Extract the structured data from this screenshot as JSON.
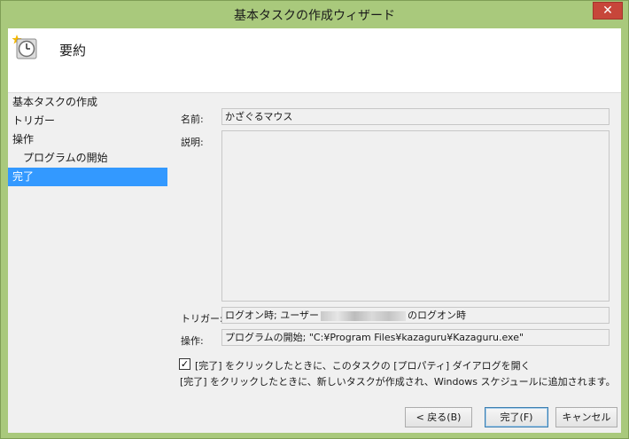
{
  "window": {
    "title": "基本タスクの作成ウィザード",
    "close_label": "✕"
  },
  "header": {
    "title": "要約",
    "icon": "scheduled-task-clock-icon"
  },
  "nav": {
    "items": [
      {
        "label": "基本タスクの作成"
      },
      {
        "label": "トリガー"
      },
      {
        "label": "操作"
      },
      {
        "label": "プログラムの開始"
      },
      {
        "label": "完了"
      }
    ],
    "active_index": 4
  },
  "form": {
    "name_label": "名前:",
    "name_value": "かざぐるマウス",
    "description_label": "説明:",
    "description_value": "",
    "trigger_label": "トリガー:",
    "trigger_prefix": "ログオン時; ユーザー",
    "trigger_suffix": "のログオン時",
    "action_label": "操作:",
    "action_value": "プログラムの開始; \"C:¥Program Files¥kazaguru¥Kazaguru.exe\""
  },
  "options": {
    "open_properties_label": "[完了] をクリックしたときに、このタスクの [プロパティ] ダイアログを開く",
    "open_properties_checked": true,
    "note": "[完了] をクリックしたときに、新しいタスクが作成され、Windows スケジュールに追加されます。"
  },
  "buttons": {
    "back": "< 戻る(B)",
    "finish": "完了(F)",
    "cancel": "キャンセル"
  },
  "colors": {
    "frame": "#a9c97c",
    "selection": "#3399ff",
    "close": "#c7463a"
  }
}
